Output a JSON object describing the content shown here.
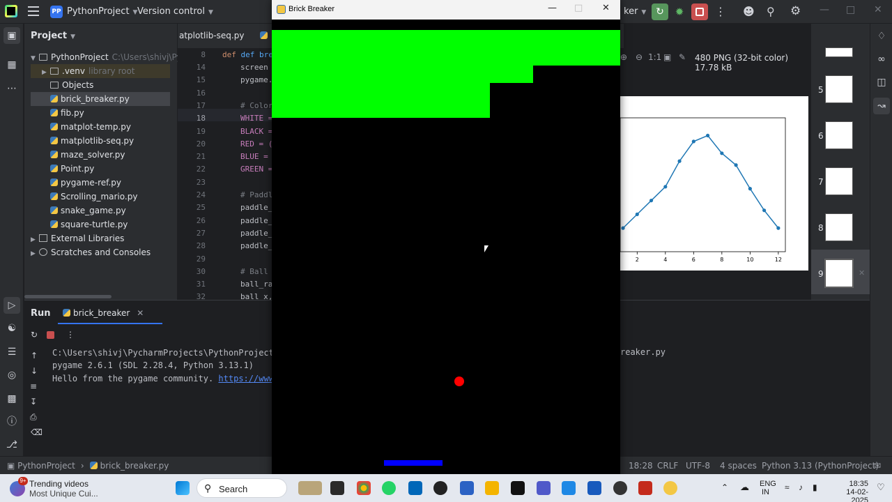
{
  "ide": {
    "project_badge": "PP",
    "project_name": "PythonProject",
    "version_control": "Version control",
    "run_config": "ker"
  },
  "project_panel": {
    "title": "Project",
    "root": "PythonProject",
    "root_path": "C:\\Users\\shivj\\Py",
    "venv": ".venv",
    "venv_hint": "library root",
    "items": [
      "Objects",
      "brick_breaker.py",
      "fib.py",
      "matplot-temp.py",
      "matplotlib-seq.py",
      "maze_solver.py",
      "Point.py",
      "pygame-ref.py",
      "Scrolling_mario.py",
      "snake_game.py",
      "square-turtle.py"
    ],
    "external": "External Libraries",
    "scratches": "Scratches and Consoles"
  },
  "editor": {
    "tab1": "atplotlib-seq.py",
    "sticky_line_no": "8",
    "sticky_code": "def break_b",
    "line_numbers": [
      "14",
      "15",
      "16",
      "17",
      "18",
      "19",
      "20",
      "21",
      "22",
      "23",
      "24",
      "25",
      "26",
      "27",
      "28",
      "29",
      "30",
      "31",
      "32"
    ],
    "lines": [
      "screen",
      "pygame.",
      "",
      "# Color",
      "WHITE =",
      "BLACK =",
      "RED = (",
      "BLUE =",
      "GREEN =",
      "",
      "# Paddl",
      "paddle_",
      "paddle_",
      "paddle_",
      "paddle_",
      "",
      "# Ball",
      "ball_ra",
      "ball_x,"
    ]
  },
  "viewer": {
    "zoom": "1:1",
    "info": "480 PNG (32-bit color) 17.78 kB",
    "thumbs": [
      "5",
      "6",
      "7",
      "8",
      "9"
    ]
  },
  "chart_data": {
    "type": "line",
    "x": [
      1,
      2,
      3,
      4,
      5,
      6,
      7,
      8,
      9,
      10,
      11,
      12
    ],
    "y": [
      0.2,
      0.9,
      1.6,
      2.3,
      3.6,
      4.6,
      4.9,
      4.0,
      3.4,
      2.2,
      1.1,
      0.2
    ],
    "xticks": [
      "2",
      "4",
      "6",
      "8",
      "10",
      "12"
    ],
    "xlim": [
      0.8,
      12.5
    ],
    "ylim": [
      -1.0,
      5.8
    ],
    "color": "#1f77b4"
  },
  "run_panel": {
    "title": "Run",
    "tab": "brick_breaker",
    "cmd": "C:\\Users\\shivj\\PycharmProjects\\PythonProject\\.v",
    "cmd_tail": "reaker.py",
    "line2": "pygame 2.6.1 (SDL 2.28.4, Python 3.13.1)",
    "line3_prefix": "Hello from the pygame community. ",
    "line3_link": "https://www.py"
  },
  "statusbar": {
    "project": "PythonProject",
    "file": "brick_breaker.py",
    "position": "18:28",
    "line_sep": "CRLF",
    "encoding": "UTF-8",
    "indent": "4 spaces",
    "interpreter": "Python 3.13 (PythonProject)"
  },
  "pygame_window": {
    "title": "Brick Breaker",
    "brick_color": "#00ff00",
    "ball_color": "#ff0000",
    "paddle_color": "#0000ff"
  },
  "taskbar": {
    "trend_title": "Trending videos",
    "trend_sub": "Most Unique Cui...",
    "trend_badge": "9+",
    "search": "Search",
    "lang1": "ENG",
    "lang2": "IN",
    "time": "18:35",
    "date": "14-02-2025"
  }
}
